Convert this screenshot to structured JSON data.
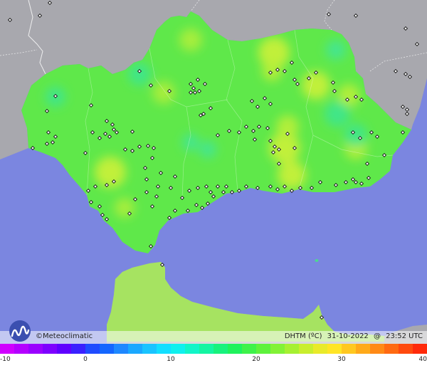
{
  "footer": {
    "brand": "©Meteoclimatic",
    "variable": "DHTM (ºC)",
    "date": "31-10-2022",
    "at": "@",
    "time": "23:52 UTC"
  },
  "scale": {
    "ticks": [
      {
        "label": "-10",
        "value": -10
      },
      {
        "label": "0",
        "value": 0
      },
      {
        "label": "10",
        "value": 10
      },
      {
        "label": "20",
        "value": 20
      },
      {
        "label": "30",
        "value": 30
      },
      {
        "label": "40",
        "value": 40
      }
    ],
    "colors": [
      "#d000ff",
      "#b400ff",
      "#9a00ff",
      "#7d00ff",
      "#5f00ff",
      "#3a20ff",
      "#1f4bff",
      "#1466ff",
      "#1e88ff",
      "#1aa8ff",
      "#19c4ff",
      "#12dfff",
      "#10f0ee",
      "#12f5c8",
      "#14f5a2",
      "#17f27d",
      "#1ff25c",
      "#3ef24a",
      "#5ef23c",
      "#82f236",
      "#a6f032",
      "#c9ee2e",
      "#e9ea2a",
      "#ffe526",
      "#ffc820",
      "#ffaa1a",
      "#ff8a16",
      "#ff6a12",
      "#ff4a0e",
      "#ff2a0a"
    ]
  },
  "colors": {
    "sea": "#7b86e0",
    "land_outside": "#a8a8ae",
    "region_base": "#5fe84a",
    "border": "#ffffff"
  },
  "icons": {
    "station": "station-marker-icon",
    "logo": "meteoclimatic-logo-icon"
  },
  "stations": [
    [
      14,
      28
    ],
    [
      56,
      22
    ],
    [
      70,
      4
    ],
    [
      78,
      135
    ],
    [
      66,
      156
    ],
    [
      68,
      186
    ],
    [
      78,
      192
    ],
    [
      74,
      200
    ],
    [
      66,
      202
    ],
    [
      46,
      208
    ],
    [
      120,
      215
    ],
    [
      128,
      148
    ],
    [
      150,
      170
    ],
    [
      158,
      175
    ],
    [
      160,
      182
    ],
    [
      148,
      188
    ],
    [
      140,
      194
    ],
    [
      154,
      192
    ],
    [
      164,
      186
    ],
    [
      130,
      186
    ],
    [
      186,
      185
    ],
    [
      176,
      210
    ],
    [
      186,
      212
    ],
    [
      196,
      206
    ],
    [
      208,
      205
    ],
    [
      216,
      208
    ],
    [
      214,
      222
    ],
    [
      204,
      236
    ],
    [
      206,
      252
    ],
    [
      226,
      243
    ],
    [
      240,
      264
    ],
    [
      246,
      248
    ],
    [
      222,
      262
    ],
    [
      206,
      270
    ],
    [
      190,
      280
    ],
    [
      160,
      255
    ],
    [
      150,
      260
    ],
    [
      134,
      262
    ],
    [
      124,
      268
    ],
    [
      128,
      284
    ],
    [
      140,
      290
    ],
    [
      144,
      302
    ],
    [
      150,
      308
    ],
    [
      182,
      300
    ],
    [
      214,
      290
    ],
    [
      220,
      276
    ],
    [
      256,
      278
    ],
    [
      266,
      268
    ],
    [
      278,
      264
    ],
    [
      290,
      262
    ],
    [
      296,
      270
    ],
    [
      306,
      262
    ],
    [
      314,
      270
    ],
    [
      318,
      262
    ],
    [
      326,
      270
    ],
    [
      300,
      276
    ],
    [
      292,
      286
    ],
    [
      284,
      292
    ],
    [
      276,
      288
    ],
    [
      264,
      296
    ],
    [
      246,
      296
    ],
    [
      238,
      306
    ],
    [
      212,
      346
    ],
    [
      228,
      372
    ],
    [
      196,
      100
    ],
    [
      212,
      120
    ],
    [
      268,
      118
    ],
    [
      272,
      124
    ],
    [
      280,
      128
    ],
    [
      274,
      130
    ],
    [
      268,
      130
    ],
    [
      288,
      118
    ],
    [
      278,
      112
    ],
    [
      238,
      128
    ],
    [
      296,
      152
    ],
    [
      286,
      160
    ],
    [
      282,
      162
    ],
    [
      306,
      190
    ],
    [
      322,
      184
    ],
    [
      336,
      186
    ],
    [
      346,
      178
    ],
    [
      356,
      184
    ],
    [
      364,
      178
    ],
    [
      376,
      180
    ],
    [
      354,
      142
    ],
    [
      362,
      150
    ],
    [
      372,
      138
    ],
    [
      380,
      146
    ],
    [
      358,
      196
    ],
    [
      380,
      198
    ],
    [
      386,
      206
    ],
    [
      392,
      210
    ],
    [
      404,
      188
    ],
    [
      384,
      214
    ],
    [
      392,
      230
    ],
    [
      414,
      208
    ],
    [
      380,
      102
    ],
    [
      390,
      98
    ],
    [
      400,
      100
    ],
    [
      410,
      88
    ],
    [
      414,
      112
    ],
    [
      418,
      118
    ],
    [
      434,
      110
    ],
    [
      444,
      102
    ],
    [
      468,
      116
    ],
    [
      470,
      128
    ],
    [
      488,
      140
    ],
    [
      500,
      136
    ],
    [
      508,
      140
    ],
    [
      530,
      192
    ],
    [
      522,
      186
    ],
    [
      496,
      186
    ],
    [
      506,
      194
    ],
    [
      540,
      218
    ],
    [
      516,
      230
    ],
    [
      518,
      250
    ],
    [
      508,
      258
    ],
    [
      500,
      256
    ],
    [
      496,
      252
    ],
    [
      486,
      256
    ],
    [
      472,
      260
    ],
    [
      450,
      256
    ],
    [
      438,
      264
    ],
    [
      422,
      264
    ],
    [
      410,
      268
    ],
    [
      400,
      262
    ],
    [
      390,
      266
    ],
    [
      380,
      262
    ],
    [
      362,
      264
    ],
    [
      346,
      262
    ],
    [
      336,
      268
    ],
    [
      566,
      186
    ],
    [
      570,
      40
    ],
    [
      586,
      62
    ],
    [
      556,
      100
    ],
    [
      570,
      104
    ],
    [
      576,
      108
    ],
    [
      566,
      150
    ],
    [
      572,
      154
    ],
    [
      572,
      160
    ],
    [
      452,
      446
    ],
    [
      462,
      20
    ],
    [
      500,
      22
    ]
  ],
  "warm_spots": [
    [
      155,
      242,
      22,
      "#c6f03a"
    ],
    [
      230,
      130,
      16,
      "#a9ee3c"
    ],
    [
      268,
      56,
      16,
      "#a9ee3c"
    ],
    [
      175,
      292,
      14,
      "#a9ee3c"
    ],
    [
      385,
      74,
      22,
      "#c6f03a"
    ],
    [
      444,
      120,
      20,
      "#c6f03a"
    ],
    [
      490,
      134,
      16,
      "#b5ef3a"
    ],
    [
      400,
      208,
      22,
      "#c6f03a"
    ],
    [
      410,
      246,
      20,
      "#c6f03a"
    ],
    [
      382,
      100,
      14,
      "#b5ef3a"
    ],
    [
      404,
      178,
      16,
      "#b5ef3a"
    ],
    [
      500,
      208,
      16,
      "#b5ef3a"
    ]
  ],
  "cool_spots": [
    [
      78,
      136,
      14,
      "#3ee68a"
    ],
    [
      196,
      104,
      16,
      "#3ee68a"
    ],
    [
      474,
      160,
      18,
      "#3ee68a"
    ],
    [
      500,
      190,
      16,
      "#3ee68a"
    ],
    [
      268,
      200,
      12,
      "#45e690"
    ],
    [
      292,
      210,
      12,
      "#45e690"
    ],
    [
      472,
      70,
      14,
      "#45e690"
    ]
  ]
}
